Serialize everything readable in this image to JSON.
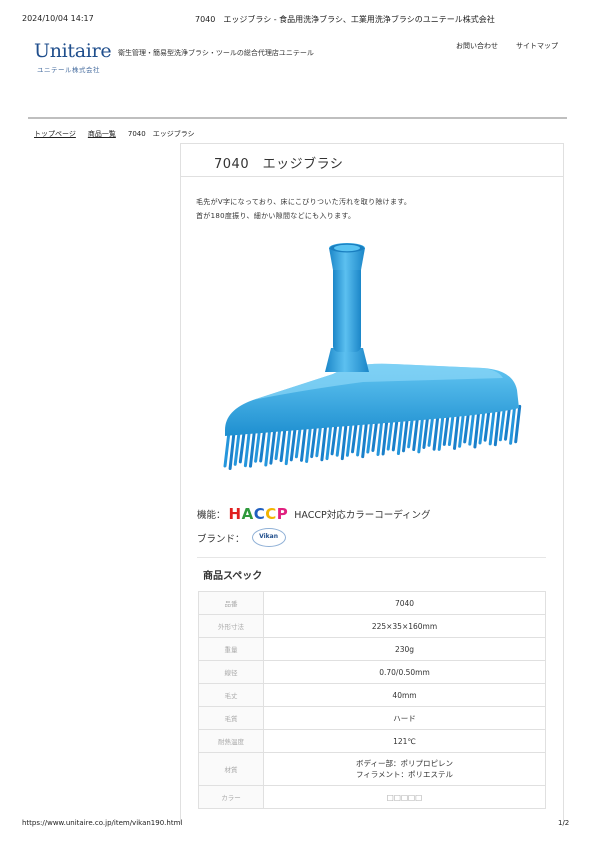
{
  "print_header": {
    "datetime": "2024/10/04 14:17",
    "page_title": "7040　エッジブラシ - 食品用洗浄ブラシ、工業用洗浄ブラシのユニテール株式会社"
  },
  "site": {
    "logo": "Unitaire",
    "logo_sub": "ユニテール株式会社",
    "tagline": "衛生管理・簡易型洗浄ブラシ・ツールの総合代理店ユニテール",
    "nav": [
      "お問い合わせ",
      "サイトマップ"
    ]
  },
  "breadcrumb": [
    "トップページ",
    "商品一覧",
    "7040　エッジブラシ"
  ],
  "product": {
    "title": "7040　エッジブラシ",
    "description": [
      "毛先がV字になっており、床にこびりついた汚れを取り除けます。",
      "首が180度振り、細かい隙間などにも入ります。"
    ],
    "feature_label": "機能：",
    "haccp_letters": [
      {
        "char": "H",
        "color": "#e02020"
      },
      {
        "char": "A",
        "color": "#2f9a3c"
      },
      {
        "char": "C",
        "color": "#1f5fbf"
      },
      {
        "char": "C",
        "color": "#f2b400"
      },
      {
        "char": "P",
        "color": "#e0207f"
      }
    ],
    "haccp_text": "HACCP対応カラーコーディング",
    "brand_label": "ブランド：",
    "brand_logo": "Vikan",
    "product_color": "#2fa7e6"
  },
  "spec": {
    "heading": "商品スペック",
    "rows": [
      {
        "key": "品番",
        "value": "7040"
      },
      {
        "key": "外形寸法",
        "value": "225×35×160mm"
      },
      {
        "key": "重量",
        "value": "230g"
      },
      {
        "key": "線径",
        "value": "0.70/0.50mm"
      },
      {
        "key": "毛丈",
        "value": "40mm"
      },
      {
        "key": "毛質",
        "value": "ハード"
      },
      {
        "key": "耐熱温度",
        "value": "121℃"
      },
      {
        "key": "材質",
        "value": "ボディー部：ポリプロピレン",
        "value2": "フィラメント：ポリエステル"
      },
      {
        "key": "カラー",
        "value": "□□□□□"
      }
    ]
  },
  "print_footer": {
    "url": "https://www.unitaire.co.jp/item/vikan190.html",
    "page": "1/2"
  }
}
